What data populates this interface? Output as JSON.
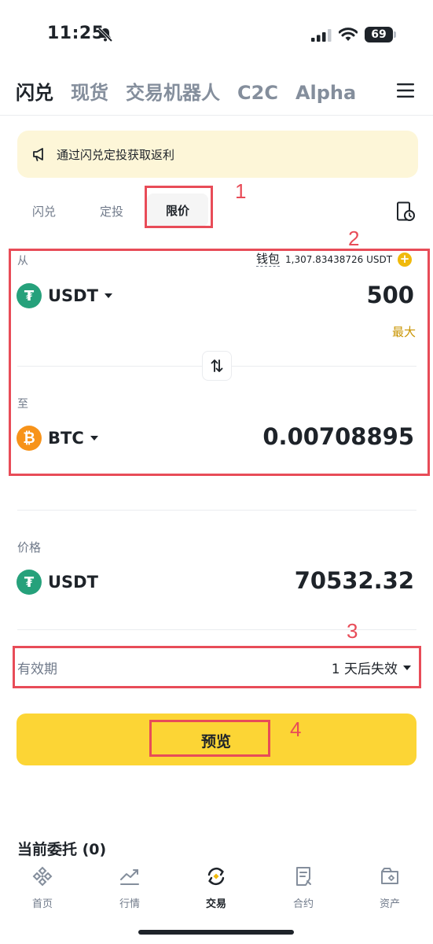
{
  "status_bar": {
    "time": "11:25",
    "battery": "69"
  },
  "top_nav": {
    "tabs": [
      {
        "label": "闪兑",
        "active": true
      },
      {
        "label": "现货"
      },
      {
        "label": "交易机器人"
      },
      {
        "label": "C2C"
      },
      {
        "label": "Alpha"
      }
    ]
  },
  "banner": {
    "text": "通过闪兑定投获取返利"
  },
  "sub_tabs": [
    {
      "label": "闪兑"
    },
    {
      "label": "定投"
    },
    {
      "label": "限价",
      "active": true
    }
  ],
  "annotations": [
    "1",
    "2",
    "3",
    "4"
  ],
  "from": {
    "label": "从",
    "wallet_label": "钱包",
    "wallet_balance": "1,307.83438726 USDT",
    "coin": "USDT",
    "amount": "500",
    "max_label": "最大"
  },
  "to": {
    "label": "至",
    "coin": "BTC",
    "amount": "0.00708895"
  },
  "price": {
    "label": "价格",
    "coin": "USDT",
    "value": "70532.32"
  },
  "validity": {
    "label": "有效期",
    "value": "1 天后失效"
  },
  "preview_button": {
    "label": "预览"
  },
  "open_orders": {
    "title": "当前委托 (0)"
  },
  "bottom_nav": [
    {
      "label": "首页",
      "icon": "home-icon"
    },
    {
      "label": "行情",
      "icon": "markets-icon"
    },
    {
      "label": "交易",
      "icon": "trade-icon",
      "active": true
    },
    {
      "label": "合约",
      "icon": "futures-icon"
    },
    {
      "label": "资产",
      "icon": "wallet-icon"
    }
  ],
  "colors": {
    "brand_yellow": "#fcd535",
    "usdt_green": "#26a17b",
    "btc_orange": "#f7931a",
    "annotation_red": "#e84c58"
  }
}
